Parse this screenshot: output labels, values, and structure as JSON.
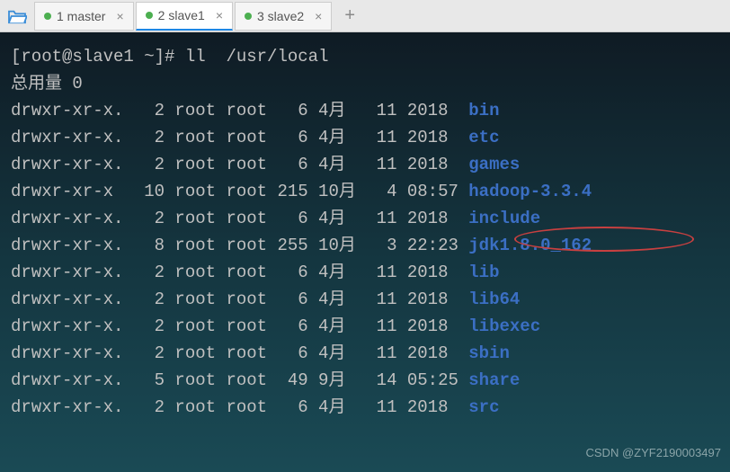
{
  "tabs": [
    {
      "label": "1 master"
    },
    {
      "label": "2 slave1"
    },
    {
      "label": "3 slave2"
    }
  ],
  "active_tab_index": 1,
  "prompt": "[root@slave1 ~]# ",
  "command": "ll  /usr/local",
  "summary": "总用量 0",
  "listing": [
    {
      "perm": "drwxr-xr-x.",
      "links": "2",
      "owner": "root",
      "group": "root",
      "size": "6",
      "month": "4月",
      "day": "11",
      "time_year": "2018",
      "name": "bin"
    },
    {
      "perm": "drwxr-xr-x.",
      "links": "2",
      "owner": "root",
      "group": "root",
      "size": "6",
      "month": "4月",
      "day": "11",
      "time_year": "2018",
      "name": "etc"
    },
    {
      "perm": "drwxr-xr-x.",
      "links": "2",
      "owner": "root",
      "group": "root",
      "size": "6",
      "month": "4月",
      "day": "11",
      "time_year": "2018",
      "name": "games"
    },
    {
      "perm": "drwxr-xr-x",
      "links": "10",
      "owner": "root",
      "group": "root",
      "size": "215",
      "month": "10月",
      "day": "4",
      "time_year": "08:57",
      "name": "hadoop-3.3.4"
    },
    {
      "perm": "drwxr-xr-x.",
      "links": "2",
      "owner": "root",
      "group": "root",
      "size": "6",
      "month": "4月",
      "day": "11",
      "time_year": "2018",
      "name": "include"
    },
    {
      "perm": "drwxr-xr-x.",
      "links": "8",
      "owner": "root",
      "group": "root",
      "size": "255",
      "month": "10月",
      "day": "3",
      "time_year": "22:23",
      "name": "jdk1.8.0_162"
    },
    {
      "perm": "drwxr-xr-x.",
      "links": "2",
      "owner": "root",
      "group": "root",
      "size": "6",
      "month": "4月",
      "day": "11",
      "time_year": "2018",
      "name": "lib"
    },
    {
      "perm": "drwxr-xr-x.",
      "links": "2",
      "owner": "root",
      "group": "root",
      "size": "6",
      "month": "4月",
      "day": "11",
      "time_year": "2018",
      "name": "lib64"
    },
    {
      "perm": "drwxr-xr-x.",
      "links": "2",
      "owner": "root",
      "group": "root",
      "size": "6",
      "month": "4月",
      "day": "11",
      "time_year": "2018",
      "name": "libexec"
    },
    {
      "perm": "drwxr-xr-x.",
      "links": "2",
      "owner": "root",
      "group": "root",
      "size": "6",
      "month": "4月",
      "day": "11",
      "time_year": "2018",
      "name": "sbin"
    },
    {
      "perm": "drwxr-xr-x.",
      "links": "5",
      "owner": "root",
      "group": "root",
      "size": "49",
      "month": "9月",
      "day": "14",
      "time_year": "05:25",
      "name": "share"
    },
    {
      "perm": "drwxr-xr-x.",
      "links": "2",
      "owner": "root",
      "group": "root",
      "size": "6",
      "month": "4月",
      "day": "11",
      "time_year": "2018",
      "name": "src"
    }
  ],
  "highlighted_entry_index": 3,
  "watermark": "CSDN @ZYF2190003497"
}
